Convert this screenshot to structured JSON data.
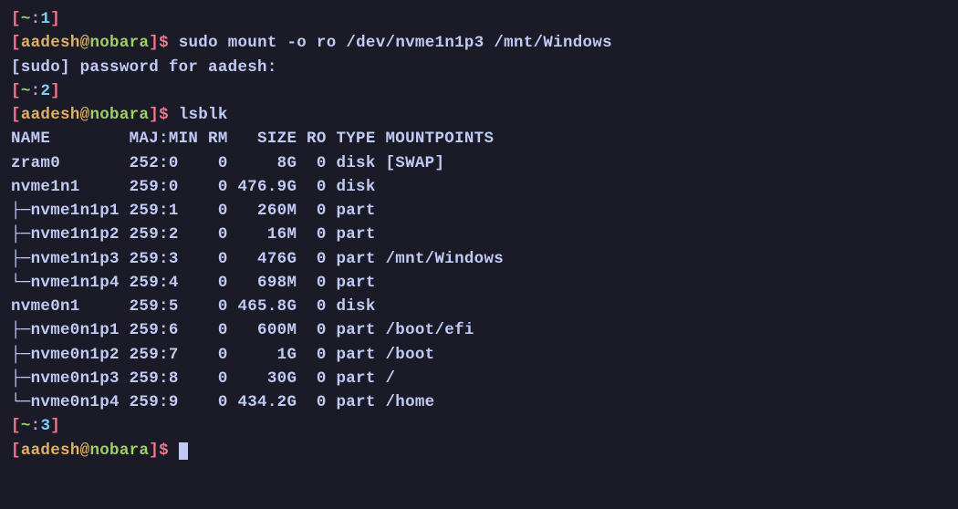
{
  "prompt1": {
    "bracket_l": "[",
    "tilde": "~",
    "colon": ":",
    "num": "1",
    "bracket_r": "]"
  },
  "prompt2": {
    "bracket_l": "[",
    "user": "aadesh",
    "at": "@",
    "host": "nobara",
    "bracket_r": "]",
    "dollar": "$"
  },
  "cmd1": "sudo mount -o ro /dev/nvme1n1p3 /mnt/Windows",
  "sudoPrompt": "[sudo] password for aadesh:",
  "prompt3": {
    "bracket_l": "[",
    "tilde": "~",
    "colon": ":",
    "num": "2",
    "bracket_r": "]"
  },
  "cmd2": "lsblk",
  "header": "NAME        MAJ:MIN RM   SIZE RO TYPE MOUNTPOINTS",
  "rows": [
    "zram0       252:0    0     8G  0 disk [SWAP]",
    "nvme1n1     259:0    0 476.9G  0 disk",
    "├─nvme1n1p1 259:1    0   260M  0 part",
    "├─nvme1n1p2 259:2    0    16M  0 part",
    "├─nvme1n1p3 259:3    0   476G  0 part /mnt/Windows",
    "└─nvme1n1p4 259:4    0   698M  0 part",
    "nvme0n1     259:5    0 465.8G  0 disk",
    "├─nvme0n1p1 259:6    0   600M  0 part /boot/efi",
    "├─nvme0n1p2 259:7    0     1G  0 part /boot",
    "├─nvme0n1p3 259:8    0    30G  0 part /",
    "└─nvme0n1p4 259:9    0 434.2G  0 part /home"
  ],
  "prompt4": {
    "bracket_l": "[",
    "tilde": "~",
    "colon": ":",
    "num": "3",
    "bracket_r": "]"
  }
}
